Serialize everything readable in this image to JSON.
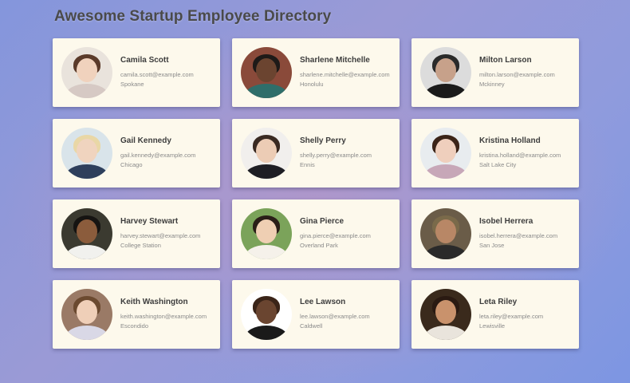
{
  "page": {
    "title": "Awesome Startup Employee Directory"
  },
  "employees": [
    {
      "name": "Camila Scott",
      "email": "camila.scott@example.com",
      "city": "Spokane",
      "avatar": {
        "bg": "#e9e3dc",
        "skin": "#f0d2bd",
        "hair": "#5a3a2a",
        "shirt": "#d6c9c4"
      }
    },
    {
      "name": "Sharlene Mitchelle",
      "email": "sharlene.mitchelle@example.com",
      "city": "Honolulu",
      "avatar": {
        "bg": "#8a4a3a",
        "skin": "#6b4430",
        "hair": "#1e1a18",
        "shirt": "#2f6e6a"
      }
    },
    {
      "name": "Milton Larson",
      "email": "milton.larson@example.com",
      "city": "Mckinney",
      "avatar": {
        "bg": "#dcdcdc",
        "skin": "#c7a18a",
        "hair": "#2a2a2a",
        "shirt": "#1b1b1b"
      }
    },
    {
      "name": "Gail Kennedy",
      "email": "gail.kennedy@example.com",
      "city": "Chicago",
      "avatar": {
        "bg": "#d9e4ea",
        "skin": "#f0d4bf",
        "hair": "#e9d7a6",
        "shirt": "#2e3f5c"
      }
    },
    {
      "name": "Shelly Perry",
      "email": "shelly.perry@example.com",
      "city": "Ennis",
      "avatar": {
        "bg": "#f1efed",
        "skin": "#ecccb5",
        "hair": "#3a2a22",
        "shirt": "#1e1e24"
      }
    },
    {
      "name": "Kristina Holland",
      "email": "kristina.holland@example.com",
      "city": "Salt Lake City",
      "avatar": {
        "bg": "#e8ecef",
        "skin": "#efcfbd",
        "hair": "#3b2418",
        "shirt": "#c7a7b8"
      }
    },
    {
      "name": "Harvey Stewart",
      "email": "harvey.stewart@example.com",
      "city": "College Station",
      "avatar": {
        "bg": "#3b3a30",
        "skin": "#8b5c3c",
        "hair": "#161412",
        "shirt": "#f1f1ee"
      }
    },
    {
      "name": "Gina Pierce",
      "email": "gina.pierce@example.com",
      "city": "Overland Park",
      "avatar": {
        "bg": "#7ba35a",
        "skin": "#efcfb3",
        "hair": "#2a1e18",
        "shirt": "#f5f1ea"
      }
    },
    {
      "name": "Isobel Herrera",
      "email": "isobel.herrera@example.com",
      "city": "San Jose",
      "avatar": {
        "bg": "#6a5c48",
        "skin": "#b88766",
        "hair": "#7a6a4a",
        "shirt": "#2a2a2a"
      }
    },
    {
      "name": "Keith Washington",
      "email": "keith.washington@example.com",
      "city": "Escondido",
      "avatar": {
        "bg": "#9a7a66",
        "skin": "#efcfb8",
        "hair": "#6b4a30",
        "shirt": "#d9d8e6"
      }
    },
    {
      "name": "Lee Lawson",
      "email": "lee.lawson@example.com",
      "city": "Caldwell",
      "avatar": {
        "bg": "#ffffff",
        "skin": "#6a4530",
        "hair": "#3a2418",
        "shirt": "#1a1a1a"
      }
    },
    {
      "name": "Leta Riley",
      "email": "leta.riley@example.com",
      "city": "Lewisville",
      "avatar": {
        "bg": "#3a2a1c",
        "skin": "#c9926c",
        "hair": "#2a1a12",
        "shirt": "#e9e4dc"
      }
    }
  ]
}
